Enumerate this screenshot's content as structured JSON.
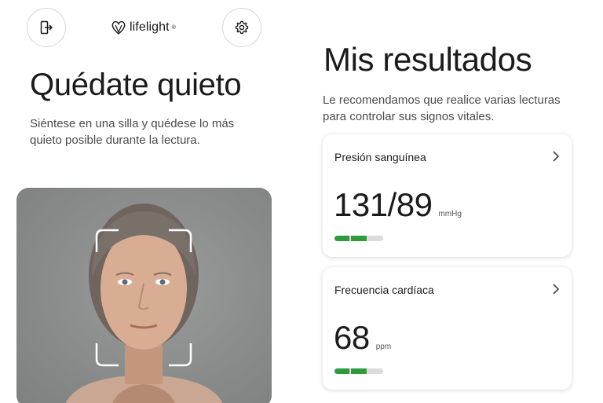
{
  "left_screen": {
    "brand": {
      "name": "lifelight",
      "mark": "®"
    },
    "exit_icon": "exit-door-icon",
    "settings_icon": "gear-icon",
    "title": "Quédate quieto",
    "instructions": "Siéntese en una silla y quédese lo más quieto posible durante la lectura."
  },
  "right_screen": {
    "title": "Mis resultados",
    "description": "Le recomendamos que realice varias lecturas para controlar sus signos vitales.",
    "cards": [
      {
        "label": "Presión sanguínea",
        "value": "131/89",
        "unit": "mmHg",
        "level": 2,
        "level_max": 3
      },
      {
        "label": "Frecuencia cardíaca",
        "value": "68",
        "unit": "ppm",
        "level": 2,
        "level_max": 3
      }
    ]
  },
  "colors": {
    "level_good": "#2f9b3c",
    "level_empty": "#dcdcdc",
    "text": "#1b1b1b"
  }
}
